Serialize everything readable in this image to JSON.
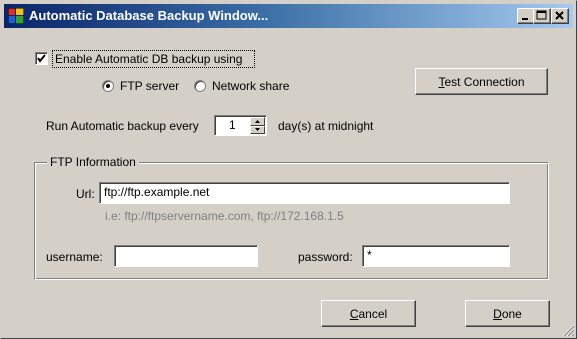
{
  "window": {
    "title": "Automatic Database Backup Window..."
  },
  "options": {
    "enable_label": "Enable Automatic DB backup using",
    "enable_checked": true,
    "radio_ftp_label": "FTP server",
    "radio_ftp_selected": true,
    "radio_network_label": "Network share",
    "radio_network_selected": false,
    "test_button_label": "Test Connection",
    "test_button_mnemonic": "T"
  },
  "schedule": {
    "prefix": "Run Automatic backup every",
    "days_value": "1",
    "suffix": "day(s) at midnight"
  },
  "ftp": {
    "group_label": "FTP Information",
    "url_label": "Url:",
    "url_value": "ftp://ftp.example.net",
    "url_hint": "i.e: ftp://ftpservername.com, ftp://172.168.1.5",
    "username_label": "username:",
    "username_value": "",
    "password_label": "password:",
    "password_value": "*"
  },
  "footer": {
    "cancel_label": "Cancel",
    "done_label": "Done"
  },
  "colors": {
    "face": "#d4d0c8",
    "title_start": "#0a246a",
    "title_end": "#a6caf0"
  },
  "icons": [
    "app-icon",
    "minimize-icon",
    "maximize-icon",
    "close-icon",
    "check-icon",
    "spin-up-icon",
    "spin-down-icon",
    "resize-grip-icon"
  ]
}
